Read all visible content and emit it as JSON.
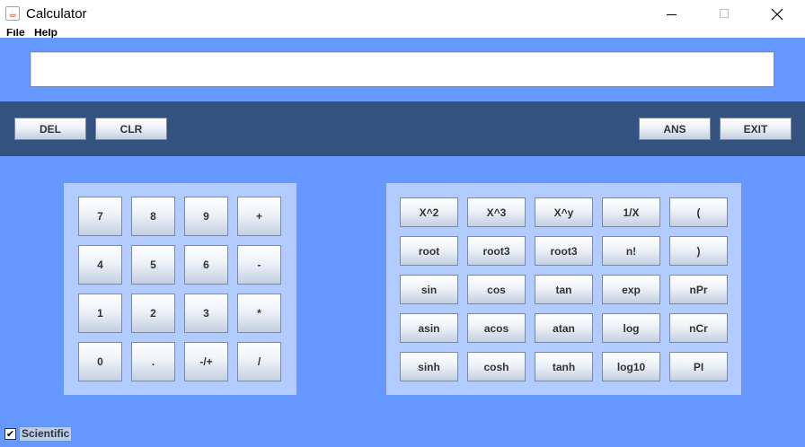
{
  "window": {
    "title": "Calculator",
    "app_icon": "java-cup-icon"
  },
  "menu": [
    "File",
    "Help"
  ],
  "display": {
    "value": ""
  },
  "toolbar": {
    "del": "DEL",
    "clr": "CLR",
    "ans": "ANS",
    "exit": "EXIT"
  },
  "numpad": [
    [
      "7",
      "8",
      "9",
      "+"
    ],
    [
      "4",
      "5",
      "6",
      "-"
    ],
    [
      "1",
      "2",
      "3",
      "*"
    ],
    [
      "0",
      ".",
      "-/+",
      "/"
    ]
  ],
  "scientific": [
    [
      "X^2",
      "X^3",
      "X^y",
      "1/X",
      "("
    ],
    [
      "root",
      "root3",
      "root3",
      "n!",
      ")"
    ],
    [
      "sin",
      "cos",
      "tan",
      "exp",
      "nPr"
    ],
    [
      "asin",
      "acos",
      "atan",
      "log",
      "nCr"
    ],
    [
      "sinh",
      "cosh",
      "tanh",
      "log10",
      "PI"
    ]
  ],
  "scientific_toggle": {
    "label": "Scientific",
    "checked": true
  },
  "colors": {
    "background": "#6699ff",
    "toolbar": "#33527f",
    "pad": "#b3ccff"
  }
}
